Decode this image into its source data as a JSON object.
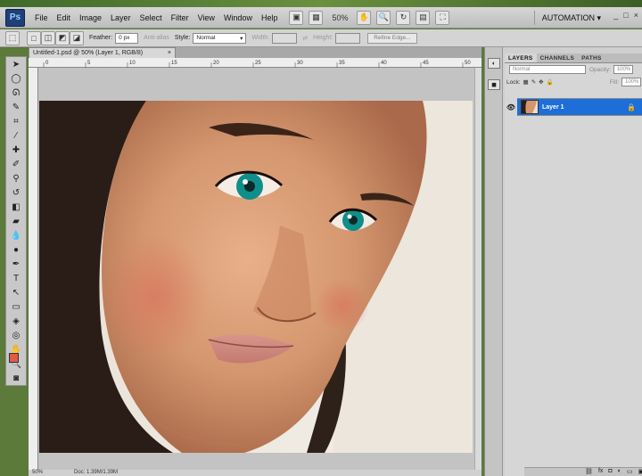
{
  "app": {
    "logo": "Ps",
    "workspace": "AUTOMATION"
  },
  "menu": [
    "File",
    "Edit",
    "Image",
    "Layer",
    "Select",
    "Filter",
    "View",
    "Window",
    "Help"
  ],
  "menubar_tools": {
    "zoom": "50%",
    "zoom_icon": "hand-icon"
  },
  "window_buttons": [
    "_",
    "□",
    "×"
  ],
  "options": {
    "feather_label": "Feather:",
    "feather_value": "0 px",
    "antialias_label": "Anti-alias",
    "style_label": "Style:",
    "style_value": "Normal",
    "width_label": "Width:",
    "height_label": "Height:",
    "refine_label": "Refine Edge..."
  },
  "document": {
    "tab_title": "Untitled-1.psd @ 50% (Layer 1, RGB/8)",
    "close": "×",
    "zoom_status": "50%",
    "doc_status": "Doc: 1.39M/1.39M",
    "ruler_marks": [
      "0",
      "5",
      "10",
      "15",
      "20",
      "25",
      "30",
      "35",
      "40",
      "45",
      "50"
    ]
  },
  "layers_panel": {
    "tabs": [
      "LAYERS",
      "CHANNELS",
      "PATHS"
    ],
    "blend_mode": "Normal",
    "opacity_label": "Opacity:",
    "opacity_value": "100%",
    "lock_label": "Lock:",
    "fill_label": "Fill:",
    "fill_value": "100%",
    "layer_name": "Layer 1"
  },
  "colors": {
    "accent": "#1d6ed8",
    "foreground_swatch": "#e15a4a",
    "background_swatch": "#ffffff"
  }
}
